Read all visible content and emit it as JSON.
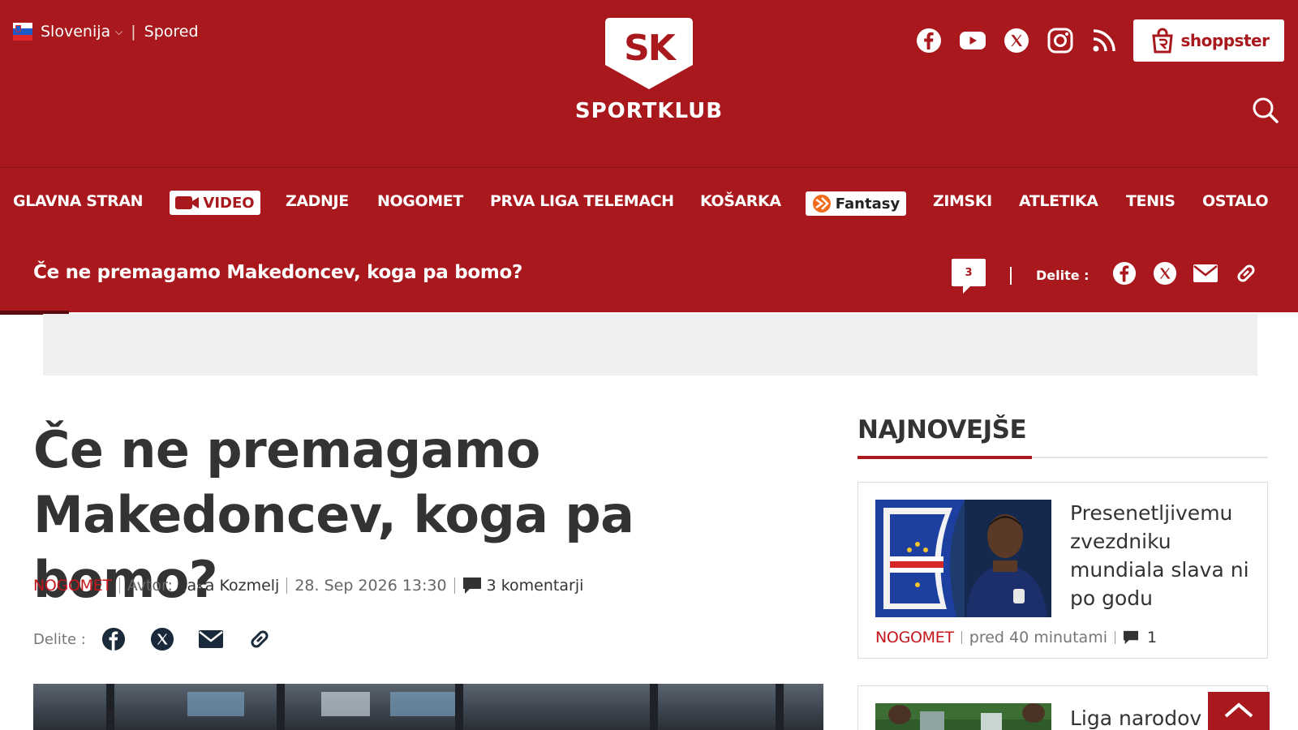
{
  "header": {
    "region": "Slovenija",
    "schedule_link": "Spored",
    "logo_text": "SPORTKLUB",
    "logo_mark": "SK",
    "shop_label": "shoppster",
    "social": [
      "facebook-icon",
      "youtube-icon",
      "x-icon",
      "instagram-icon",
      "rss-icon"
    ]
  },
  "nav": {
    "items": [
      {
        "label": "GLAVNA STRAN"
      },
      {
        "label": "VIDEO"
      },
      {
        "label": "ZADNJE"
      },
      {
        "label": "NOGOMET"
      },
      {
        "label": "PRVA LIGA TELEMACH"
      },
      {
        "label": "KOŠARKA"
      },
      {
        "label": "Fantasy"
      },
      {
        "label": "ZIMSKI"
      },
      {
        "label": "ATLETIKA"
      },
      {
        "label": "TENIS"
      },
      {
        "label": "OSTALO"
      }
    ]
  },
  "sticky": {
    "title": "Če ne premagamo Makedoncev, koga pa bomo?",
    "comment_count": "3",
    "share_label": "Delite :"
  },
  "article": {
    "title": "Če ne premagamo Makedoncev, koga pa bomo?",
    "category": "NOGOMET",
    "author_label": "Avtor:",
    "author": "Jaka Kozmelj",
    "date": "28. Sep 2026 13:30",
    "comments": "3 komentarji",
    "share_label": "Delite :"
  },
  "sidebar": {
    "heading": "NAJNOVEJŠE",
    "cards": [
      {
        "title": "Presenetljivemu zvezdniku mundiala slava ni po godu",
        "category": "NOGOMET",
        "time": "pred 40 minutami",
        "comments": "1"
      },
      {
        "title": "Liga narodov n"
      }
    ]
  },
  "colors": {
    "brand_red": "#a8181c",
    "category_red": "#c4161c"
  }
}
